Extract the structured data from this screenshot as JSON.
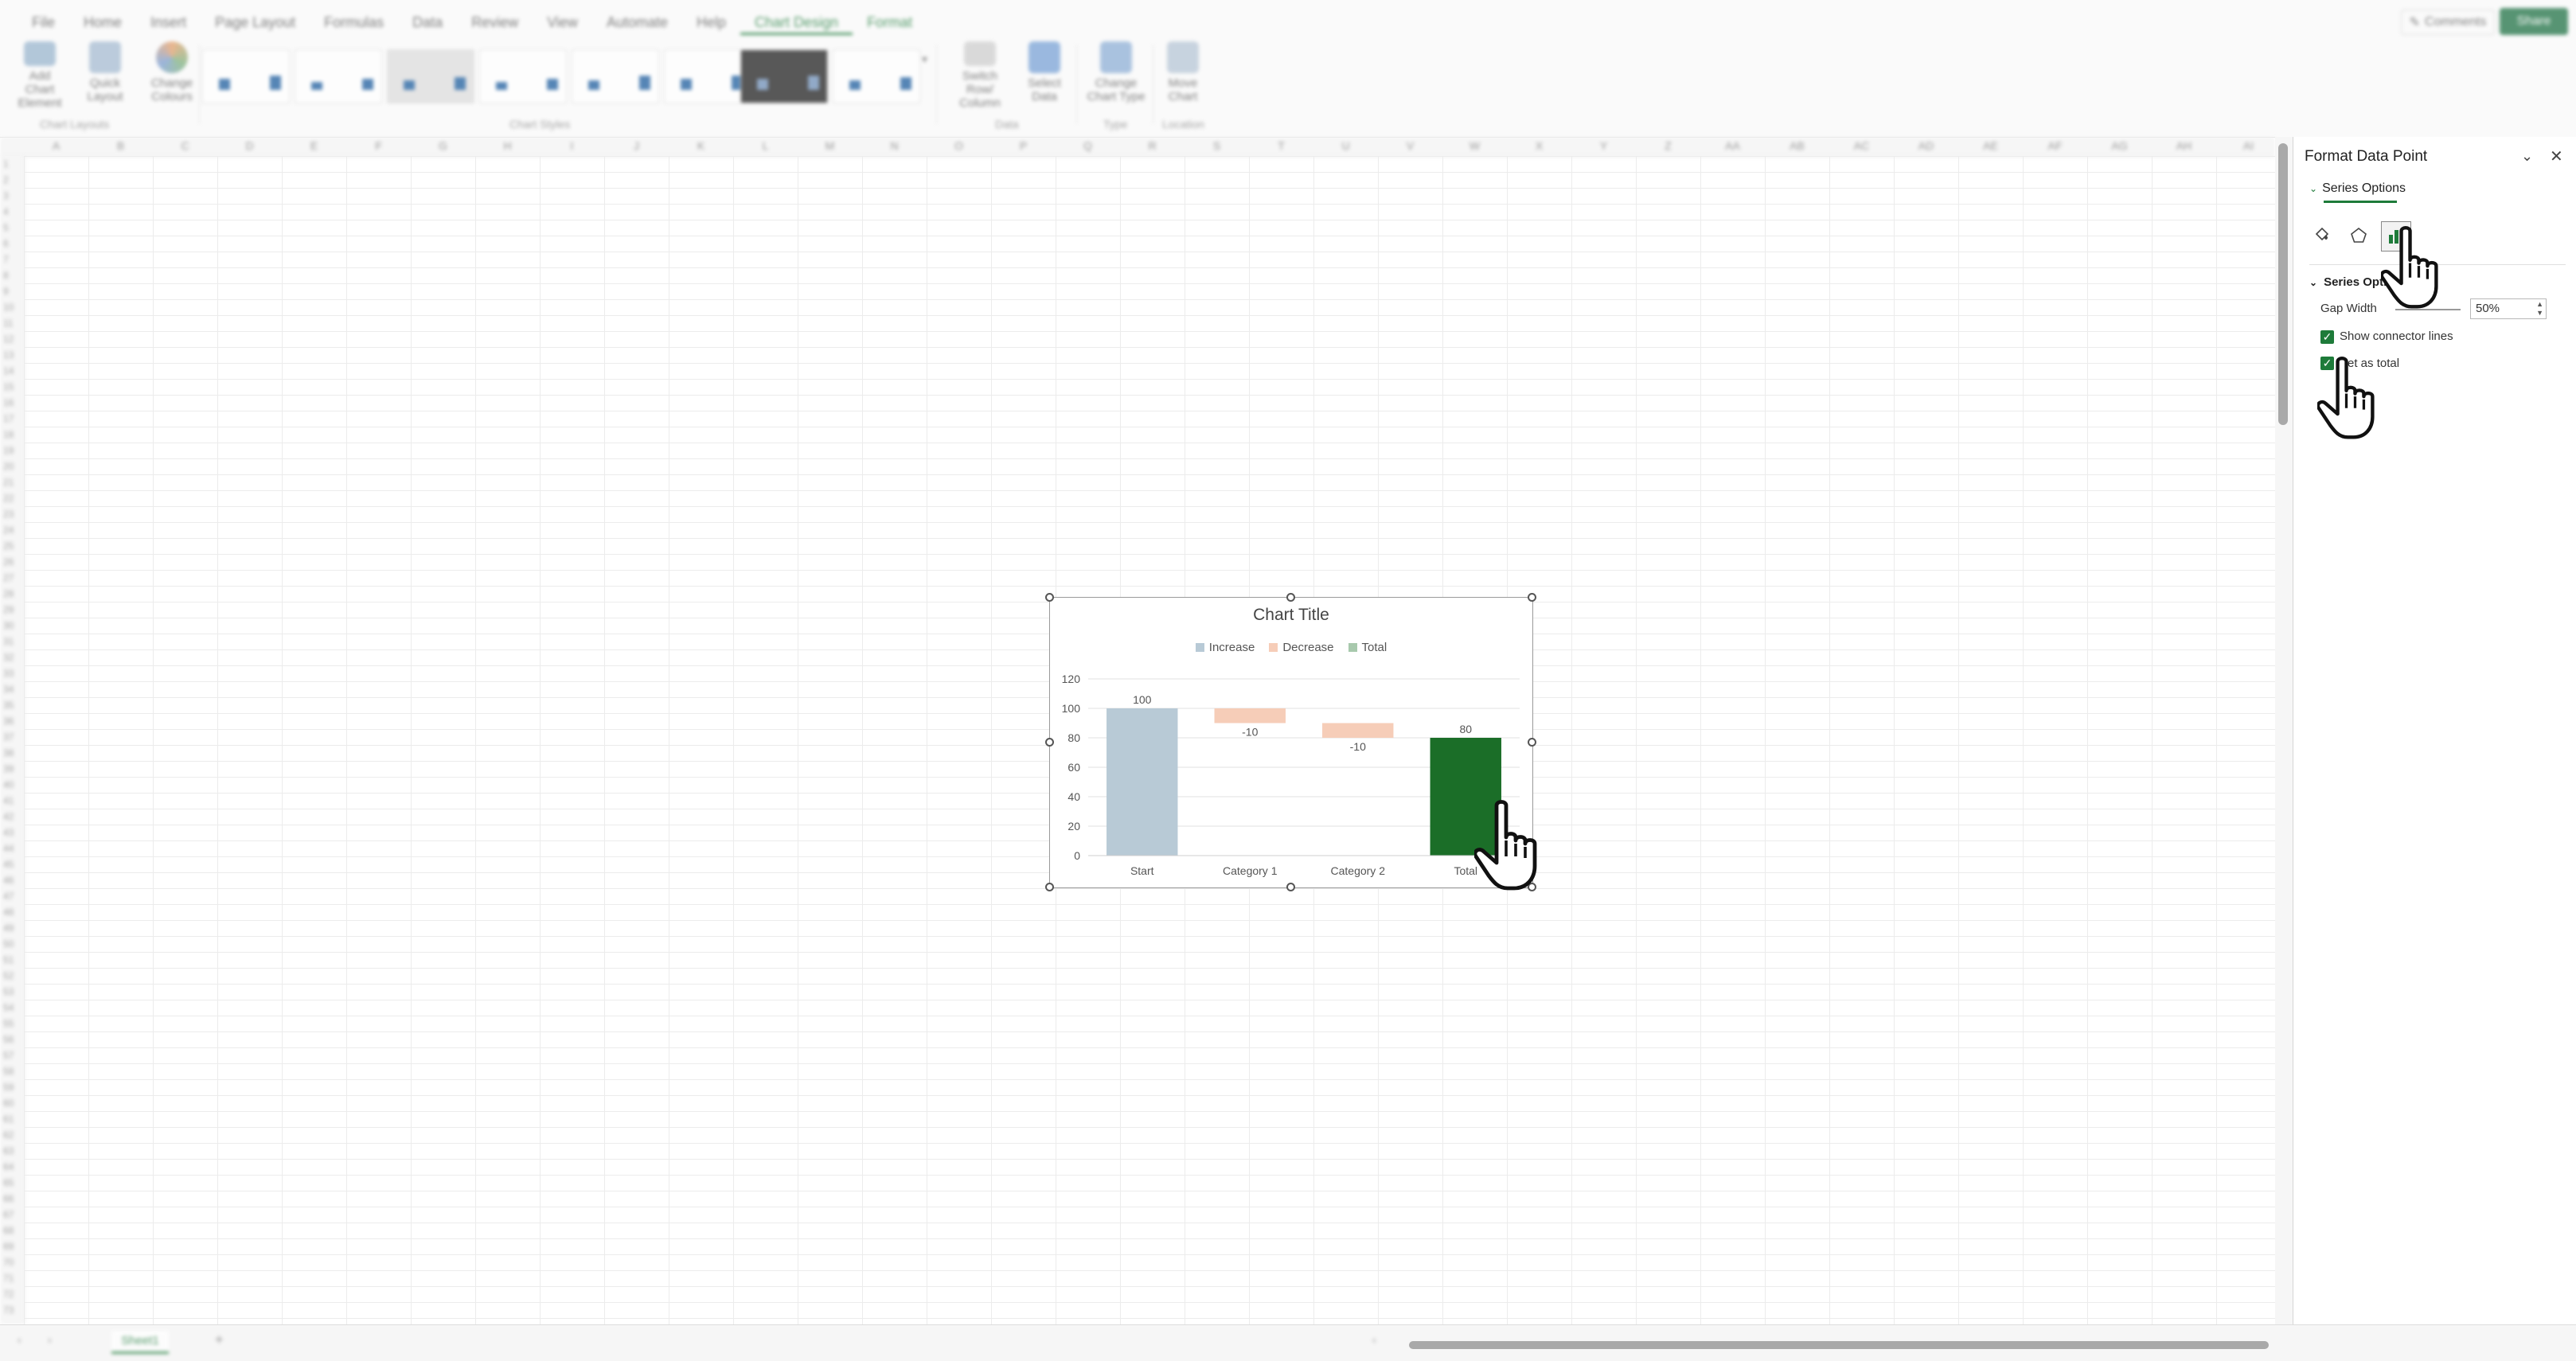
{
  "menu": {
    "tabs": [
      "File",
      "Home",
      "Insert",
      "Page Layout",
      "Formulas",
      "Data",
      "Review",
      "View",
      "Automate",
      "Help",
      "Chart Design",
      "Format"
    ],
    "active": "Chart Design",
    "comments": "Comments",
    "share": "Share"
  },
  "ribbon": {
    "buttons": [
      {
        "label": "Add Chart Element"
      },
      {
        "label": "Quick Layout"
      },
      {
        "label": "Change Colours"
      },
      {
        "label": "Switch Row/ Column"
      },
      {
        "label": "Select Data"
      },
      {
        "label": "Change Chart Type"
      },
      {
        "label": "Move Chart"
      }
    ],
    "groups": [
      "Chart Layouts",
      "Chart Styles",
      "Data",
      "Type",
      "Location"
    ]
  },
  "columns": [
    "A",
    "B",
    "C",
    "D",
    "E",
    "F",
    "G",
    "H",
    "I",
    "J",
    "K",
    "L",
    "M",
    "N",
    "O",
    "P",
    "Q",
    "R",
    "S",
    "T",
    "U",
    "V",
    "W",
    "X",
    "Y",
    "Z",
    "AA",
    "AB",
    "AC",
    "AD",
    "AE",
    "AF",
    "AG",
    "AH",
    "AI"
  ],
  "sheet": {
    "tab": "Sheet1",
    "add": "+"
  },
  "chart": {
    "title": "Chart Title",
    "legend": [
      {
        "name": "Increase",
        "color": "#b8cad6"
      },
      {
        "name": "Decrease",
        "color": "#f6cdb8"
      },
      {
        "name": "Total",
        "color": "#a8c9ad"
      }
    ]
  },
  "chart_data": {
    "type": "bar",
    "subtype": "waterfall",
    "title": "Chart Title",
    "categories": [
      "Start",
      "Category 1",
      "Category 2",
      "Total"
    ],
    "values": [
      100,
      -10,
      -10,
      80
    ],
    "data_labels": [
      "100",
      "-10",
      "-10",
      "80"
    ],
    "roles": [
      "increase",
      "decrease",
      "decrease",
      "total"
    ],
    "colors": {
      "increase": "#b8cad6",
      "decrease": "#f6cdb8",
      "total_selected": "#1b6e28"
    },
    "yticks": [
      0,
      20,
      40,
      60,
      80,
      100,
      120
    ],
    "ylim": [
      0,
      120
    ],
    "legend": [
      "Increase",
      "Decrease",
      "Total"
    ],
    "legend_position": "top",
    "grid": true
  },
  "pane": {
    "title": "Format Data Point",
    "tab": "Series Options",
    "section": "Series Opti",
    "gap_width_label": "Gap Width",
    "gap_width_value": "50%",
    "show_connector_label": "Show connector lines",
    "set_total_label": "Set as total"
  },
  "icons": {
    "fill": "paint-bucket-icon",
    "effects": "pentagon-icon",
    "series": "bar-chart-icon",
    "cursor": "hand-pointer-icon"
  }
}
